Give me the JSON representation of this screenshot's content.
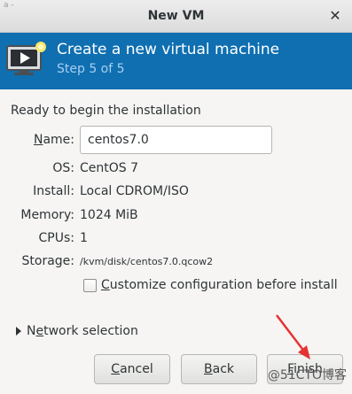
{
  "window": {
    "title": "New VM",
    "close_glyph": "✕",
    "ghost_text": "a -",
    "colors": {
      "banner_bg": "#0f6fb1",
      "banner_sub": "#a9cff0",
      "arrow": "#e53333"
    }
  },
  "banner": {
    "icon": "vm-monitor-icon",
    "title": "Create a new virtual machine",
    "step": "Step 5 of 5"
  },
  "summary": {
    "heading": "Ready to begin the installation",
    "name_label_prefix": "",
    "name_label_mnemonic": "N",
    "name_label_rest": "ame:",
    "name_value": "centos7.0",
    "os_label": "OS:",
    "os_value": "CentOS 7",
    "install_label": "Install:",
    "install_value": "Local CDROM/ISO",
    "memory_label": "Memory:",
    "memory_value": "1024 MiB",
    "cpus_label": "CPUs:",
    "cpus_value": "1",
    "storage_label": "Storage:",
    "storage_value": "/kvm/disk/centos7.0.qcow2"
  },
  "customize": {
    "mnemonic": "C",
    "rest": "ustomize configuration before install",
    "checked": false
  },
  "network": {
    "prefix": "N",
    "mnemonic": "e",
    "rest": "twork selection"
  },
  "buttons": {
    "cancel_mnemonic": "C",
    "cancel_rest": "ancel",
    "back_mnemonic": "B",
    "back_rest": "ack",
    "finish_mnemonic": "F",
    "finish_rest": "inish"
  },
  "watermark": "@51CTO博客"
}
